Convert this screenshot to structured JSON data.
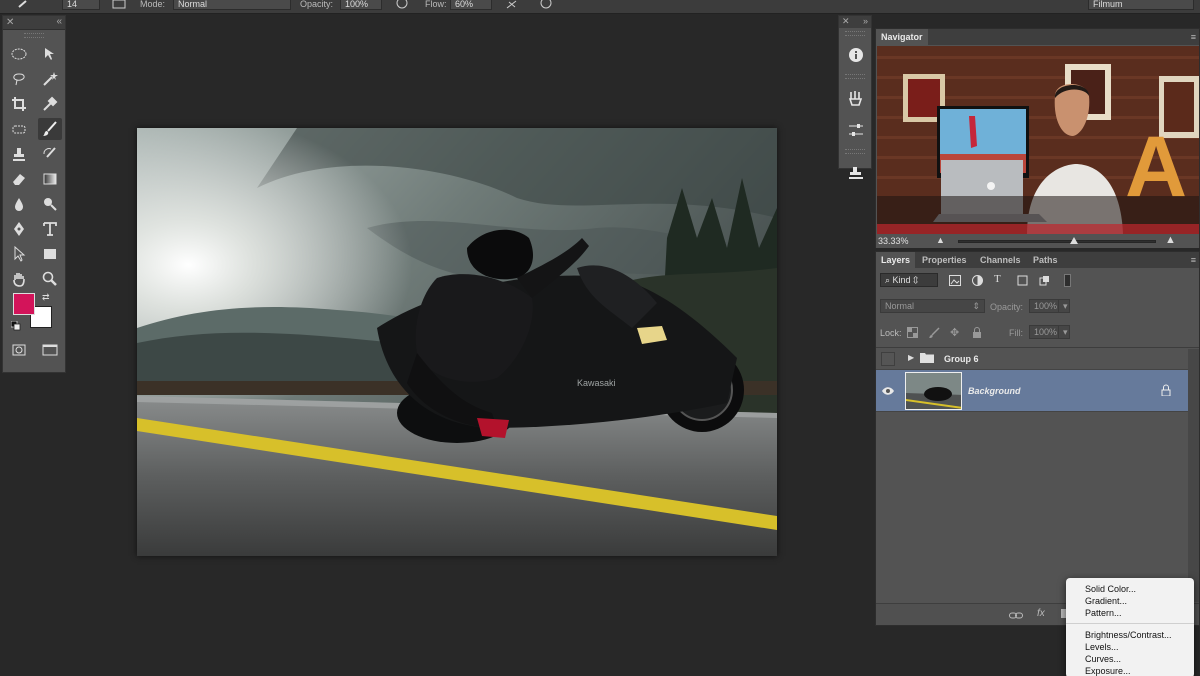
{
  "options_bar": {
    "brush_size": "14",
    "mode_label": "Mode:",
    "mode_value": "Normal",
    "opacity_label": "Opacity:",
    "opacity_value": "100%",
    "flow_label": "Flow:",
    "flow_value": "60%",
    "workspace": "Filmum"
  },
  "tools": {
    "foreground_color": "#d3145a",
    "background_color": "#ffffff",
    "items": [
      "marquee-icon",
      "move-icon",
      "lasso-icon",
      "magic-wand-icon",
      "crop-icon",
      "eyedropper-icon",
      "healing-icon",
      "brush-icon",
      "clone-stamp-icon",
      "history-brush-icon",
      "eraser-icon",
      "gradient-icon",
      "blur-icon",
      "dodge-icon",
      "pen-icon",
      "type-icon",
      "path-select-icon",
      "shape-icon",
      "hand-icon",
      "zoom-icon"
    ]
  },
  "dock": {
    "icons": [
      "info-icon",
      "brush-presets-icon",
      "adjustments-icon",
      "clone-source-icon"
    ]
  },
  "navigator": {
    "tab": "Navigator",
    "zoom": "33.33%",
    "zoom_fraction": 0.58
  },
  "layers": {
    "tabs": [
      "Layers",
      "Properties",
      "Channels",
      "Paths"
    ],
    "filter_kind": "Kind",
    "blend_mode": "Normal",
    "opacity_label": "Opacity:",
    "opacity_value": "100%",
    "lock_label": "Lock:",
    "fill_label": "Fill:",
    "fill_value": "100%",
    "items": [
      {
        "name": "Group 6",
        "visible": false,
        "type": "group"
      },
      {
        "name": "Background",
        "visible": true,
        "type": "image",
        "selected": true
      }
    ]
  },
  "adjustment_menu": {
    "group1": [
      "Solid Color...",
      "Gradient...",
      "Pattern..."
    ],
    "group2": [
      "Brightness/Contrast...",
      "Levels...",
      "Curves...",
      "Exposure..."
    ]
  },
  "colors": {
    "selected_layer": "#667a9b",
    "panel": "#535353",
    "app_bg": "#282828"
  }
}
